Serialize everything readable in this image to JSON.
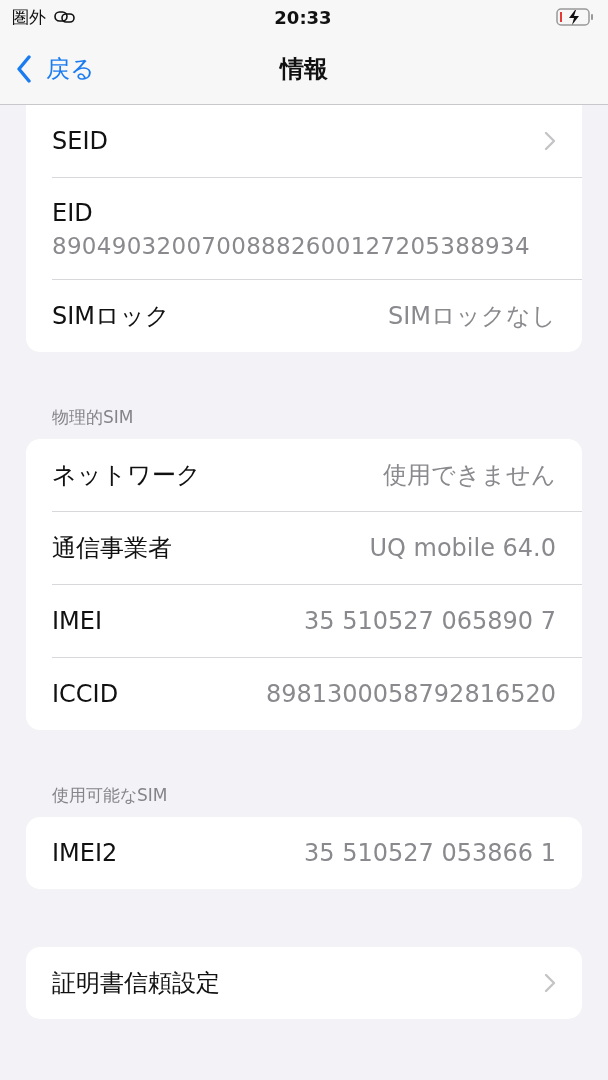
{
  "status_bar": {
    "carrier": "圏外",
    "time": "20:33",
    "charging": true
  },
  "nav": {
    "back": "戻る",
    "title": "情報"
  },
  "groups": [
    {
      "rows": [
        {
          "kind": "chevron",
          "label": "SEID"
        },
        {
          "kind": "stacked",
          "label": "EID",
          "value": "89049032007008882600127205388934"
        },
        {
          "kind": "value",
          "label": "SIMロック",
          "value": "SIMロックなし"
        }
      ]
    },
    {
      "header": "物理的SIM",
      "rows": [
        {
          "kind": "value",
          "label": "ネットワーク",
          "value": "使用できません"
        },
        {
          "kind": "value",
          "label": "通信事業者",
          "value": "UQ mobile 64.0"
        },
        {
          "kind": "value",
          "label": "IMEI",
          "value": "35 510527 065890 7"
        },
        {
          "kind": "value",
          "label": "ICCID",
          "value": "8981300058792816520"
        }
      ]
    },
    {
      "header": "使用可能なSIM",
      "rows": [
        {
          "kind": "value",
          "label": "IMEI2",
          "value": "35 510527 053866 1"
        }
      ]
    },
    {
      "rows": [
        {
          "kind": "chevron",
          "label": "証明書信頼設定"
        }
      ]
    }
  ]
}
